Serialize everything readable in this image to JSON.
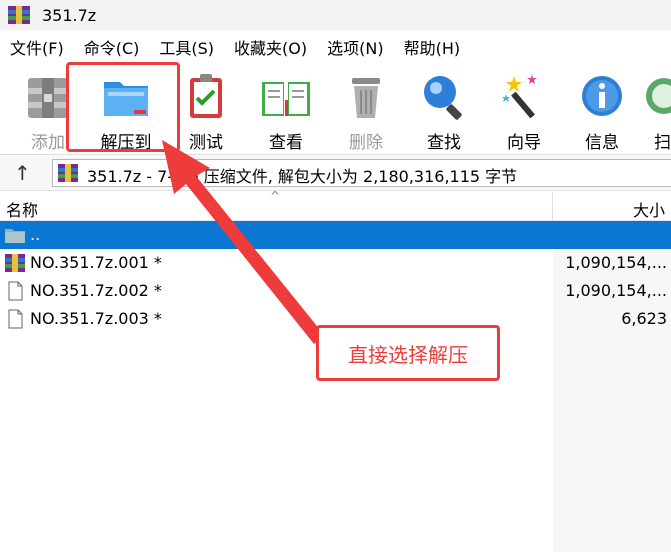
{
  "window": {
    "title": "351.7z",
    "app_icon": "winrar-archive-icon"
  },
  "menu": [
    "文件(F)",
    "命令(C)",
    "工具(S)",
    "收藏夹(O)",
    "选项(N)",
    "帮助(H)"
  ],
  "toolbar": {
    "items": [
      {
        "label": "添加",
        "icon": "add-archive-icon",
        "disabled": true
      },
      {
        "label": "解压到",
        "icon": "extract-folder-icon",
        "disabled": false
      },
      {
        "label": "测试",
        "icon": "test-clipboard-icon",
        "disabled": false
      },
      {
        "label": "查看",
        "icon": "view-book-icon",
        "disabled": false
      },
      {
        "label": "删除",
        "icon": "delete-trash-icon",
        "disabled": true
      },
      {
        "label": "查找",
        "icon": "find-magnifier-icon",
        "disabled": false
      },
      {
        "label": "向导",
        "icon": "wizard-wand-icon",
        "disabled": false
      },
      {
        "label": "信息",
        "icon": "info-icon",
        "disabled": false
      },
      {
        "label": "扫",
        "icon": "scan-icon",
        "disabled": false
      }
    ]
  },
  "pathbar": {
    "up_symbol": "↑",
    "text": "351.7z - 7-Zip 压缩文件, 解包大小为 2,180,316,115 字节"
  },
  "columns": {
    "name": "名称",
    "size": "大小",
    "sort_caret": "^"
  },
  "rows": [
    {
      "name": "..",
      "size": "",
      "icon": "folder-up-icon"
    },
    {
      "name": "NO.351.7z.001 *",
      "size": "1,090,154,...",
      "icon": "winrar-archive-icon"
    },
    {
      "name": "NO.351.7z.002 *",
      "size": "1,090,154,...",
      "icon": "file-icon"
    },
    {
      "name": "NO.351.7z.003 *",
      "size": "6,623",
      "icon": "file-icon"
    }
  ],
  "annotation": {
    "callout_text": "直接选择解压",
    "color": "#ee3b3b"
  },
  "colors": {
    "selection": "#0a77d3",
    "annotation": "#ee3b3b"
  }
}
